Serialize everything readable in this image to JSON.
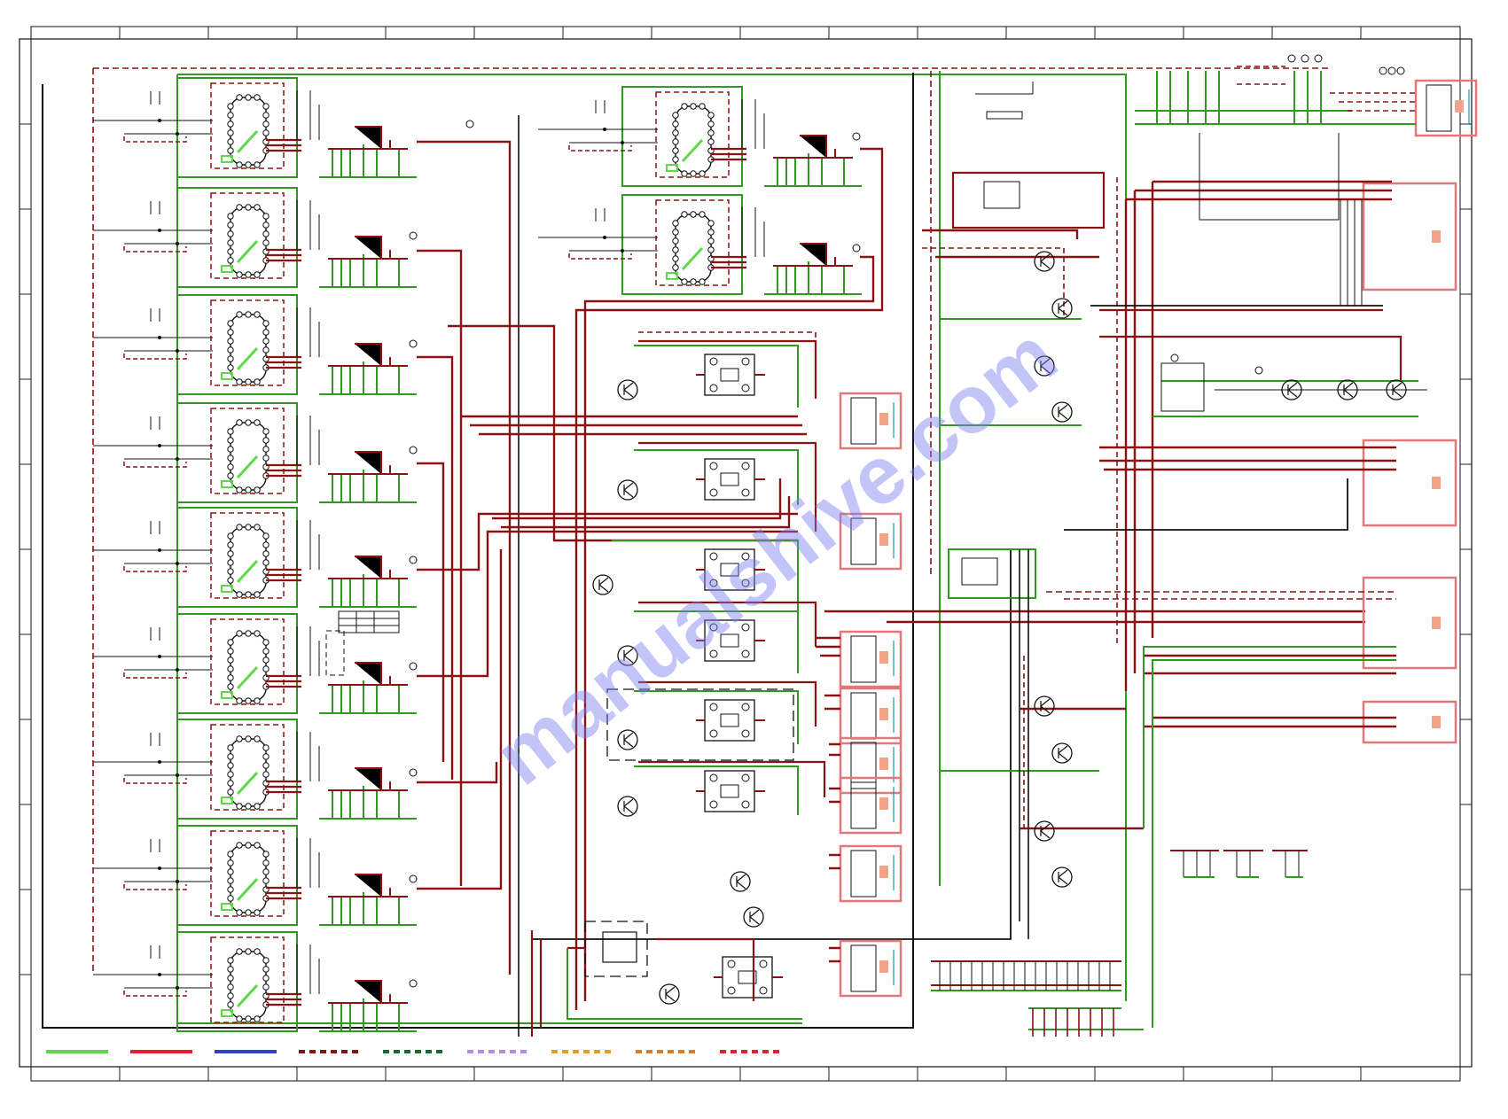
{
  "watermark": {
    "text": "manualshive.com",
    "color": "#7b7ff0"
  },
  "colors": {
    "frame": "#222222",
    "green_net": "#2e9b1e",
    "red_net": "#8a1212",
    "dark_red": "#6a0000",
    "black_net": "#111111",
    "connector": "#e07a7a",
    "connector_fill": "#f2a48a",
    "ic_green": "#5fd94a"
  },
  "legend": [
    {
      "color": "#5fd94a",
      "style": "solid"
    },
    {
      "color": "#e0202a",
      "style": "solid"
    },
    {
      "color": "#2b3fd6",
      "style": "solid"
    },
    {
      "color": "#8a1212",
      "style": "dashed"
    },
    {
      "color": "#1d6b2a",
      "style": "dashed"
    },
    {
      "color": "#b48ce6",
      "style": "dashed"
    },
    {
      "color": "#e0a020",
      "style": "dashed"
    },
    {
      "color": "#e07a20",
      "style": "dashed"
    },
    {
      "color": "#e0202a",
      "style": "dashed"
    }
  ]
}
